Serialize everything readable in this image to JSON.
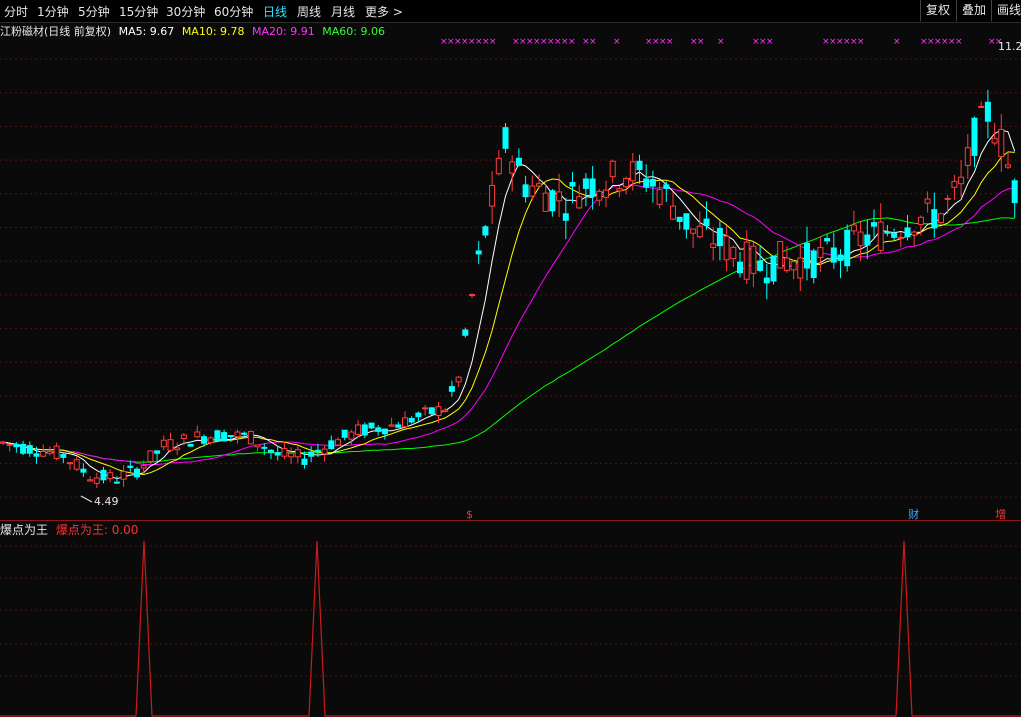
{
  "toolbar": {
    "periods": [
      "分时",
      "1分钟",
      "5分钟",
      "15分钟",
      "30分钟",
      "60分钟",
      "日线",
      "周线",
      "月线",
      "更多 >"
    ],
    "active_index": 6,
    "right_buttons": [
      "复权",
      "叠加",
      "画线"
    ]
  },
  "legend": {
    "title": "江粉磁材(日线 前复权)",
    "ma5": "MA5: 9.67",
    "ma10": "MA10: 9.78",
    "ma20": "MA20: 9.91",
    "ma60": "MA60: 9.06"
  },
  "sub_indicator": {
    "name": "爆点为王",
    "value_label": "爆点为王: 0.00"
  },
  "colors": {
    "up": "#ff3b3b",
    "down": "#00ffff",
    "ma5": "#ffffff",
    "ma10": "#ffff00",
    "ma20": "#ff00ff",
    "ma60": "#00ff00",
    "grid": "#5a1010",
    "signal": "#cc1a1a"
  },
  "chart_data": {
    "type": "candlestick",
    "title": "江粉磁材(日线 前复权)",
    "y_range": [
      3.9,
      11.5
    ],
    "price_labels": {
      "high": "11.2",
      "low": "4.49"
    },
    "x_markers": [
      {
        "label": "$",
        "index": 70
      },
      {
        "label": "财",
        "index": 136
      },
      {
        "label": "增",
        "index": 149
      }
    ],
    "candles": [],
    "ma5": [],
    "ma10": [],
    "ma20": [],
    "ma60": [],
    "signal_peaks": [
      22,
      50,
      143
    ],
    "signal_value": "0.00"
  }
}
